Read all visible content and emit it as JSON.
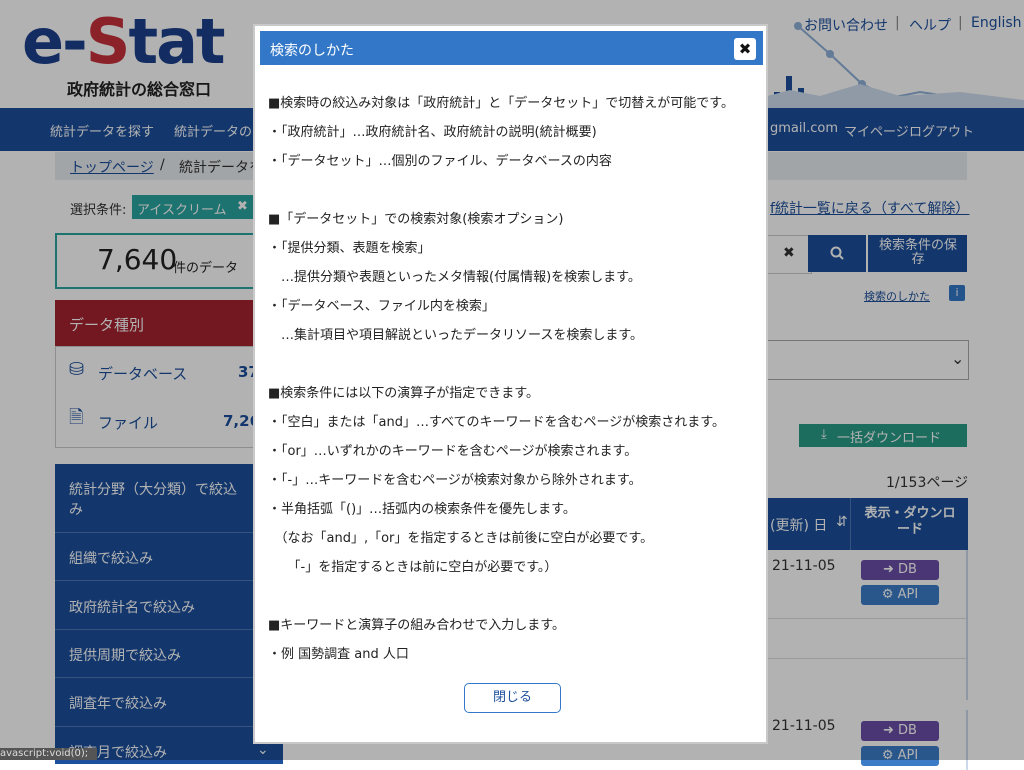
{
  "header": {
    "logo_e": "e-",
    "logo_s": "S",
    "logo_tat": "tat",
    "logo_sub": "政府統計の総合窓口",
    "links": [
      "お問い合わせ",
      "ヘルプ",
      "English"
    ],
    "separator": "|"
  },
  "nav": {
    "items": [
      "統計データを探す",
      "統計データの"
    ],
    "account_email": "gmail.com",
    "mypage": "マイページ",
    "logout": "ログアウト"
  },
  "breadcrumb": {
    "home": "トップページ",
    "sep": "/",
    "current": "統計データを"
  },
  "conditions": {
    "label": "選択条件:",
    "tag": "アイスクリーム",
    "back_link": "f統計一覧に戻る（すべて解除）"
  },
  "result": {
    "count": "7,640",
    "unit": "件のデータ"
  },
  "data_type": {
    "heading": "データ種別",
    "items": [
      {
        "label": "データベース",
        "count": "37"
      },
      {
        "label": "ファイル",
        "count": "7,26"
      }
    ]
  },
  "filters": [
    "統計分野（大分類）で絞込み",
    "組織で絞込み",
    "政府統計名で絞込み",
    "提供周期で絞込み",
    "調査年で絞込み",
    "調査月で絞込み"
  ],
  "search": {
    "clear": "✖",
    "save_label": "検索条件の保存",
    "help_link": "検索のしかた"
  },
  "download": {
    "bulk_label": "一括ダウンロード"
  },
  "pagination": {
    "indicator": "1/153ページ"
  },
  "table": {
    "col_date": "(更新) 日",
    "col_view": "表示・ダウンロード",
    "rows": [
      {
        "date": "21-11-05",
        "db": "DB",
        "api": "API"
      },
      {
        "date": "21-11-05",
        "db": "DB",
        "api": "API"
      }
    ]
  },
  "modal": {
    "title": "検索のしかた",
    "close_x": "✖",
    "lines": [
      "■検索時の絞込み対象は「政府統計」と「データセット」で切替えが可能です。",
      "・「政府統計」…政府統計名、政府統計の説明(統計概要)",
      "・「データセット」…個別のファイル、データベースの内容",
      "",
      "■「データセット」での検索対象(検索オプション)",
      "・「提供分類、表題を検索」",
      "　…提供分類や表題といったメタ情報(付属情報)を検索します。",
      "・「データベース、ファイル内を検索」",
      "　…集計項目や項目解説といったデータリソースを検索します。",
      "",
      "■検索条件には以下の演算子が指定できます。",
      "・「空白」または「and」…すべてのキーワードを含むページが検索されます。",
      "・「or」…いずれかのキーワードを含むページが検索されます。",
      "・「-」…キーワードを含むページが検索対象から除外されます。",
      "・半角括弧「()」…括弧内の検索条件を優先します。",
      "　（なお「and」,「or」を指定するときは前後に空白が必要です。",
      "　　「-」を指定するときは前に空白が必要です。）",
      "",
      "■キーワードと演算子の組み合わせで入力します。",
      "・例 国勢調査 and 人口"
    ],
    "close_button": "閉じる"
  },
  "status_tooltip": "avascript:void(0);"
}
